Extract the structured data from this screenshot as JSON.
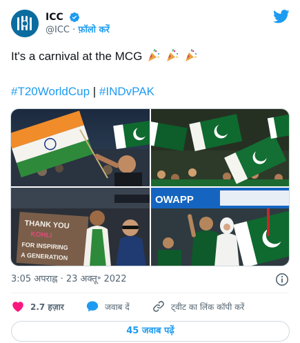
{
  "account": {
    "display_name": "ICC",
    "handle": "@ICC",
    "dot": "·",
    "follow_label": "फ़ॉलो करें",
    "avatar_icon": "icc-logo-icon",
    "verified_icon": "verified-badge-icon"
  },
  "brand": {
    "logo_icon": "twitter-bird-icon",
    "accent": "#1d9bf0"
  },
  "tweet": {
    "text": "It's a carnival at the MCG",
    "emoji_icon": "party-popper-icon",
    "hashtags": [
      "#T20WorldCup",
      "#INDvPAK"
    ],
    "separator": "|"
  },
  "media": {
    "photo_1": {
      "kind": "india-flag-fan-photo"
    },
    "photo_2": {
      "kind": "pakistan-flags-crowd-photo"
    },
    "photo_3": {
      "kind": "fans-with-banner-photo",
      "sign_lines": [
        "THANK YOU",
        "KOHLI",
        "FOR INSPIRING",
        "A GENERATION"
      ]
    },
    "photo_4": {
      "kind": "pakistan-fans-stands-photo",
      "banner_text": "OWAPP"
    }
  },
  "meta": {
    "time": "3:05 अपराह्न",
    "dot": "·",
    "date": "23 अक्तू॰ 2022",
    "info_icon": "info-circle-icon"
  },
  "actions": {
    "like_count": "2.7 हज़ार",
    "reply_label": "जवाब दें",
    "copy_link_label": "ट्वीट का लिंक कॉपी करें"
  },
  "read_replies_label": "45 जवाब पढ़ें",
  "colors": {
    "like": "#f91880",
    "reply": "#1d9bf0",
    "text_secondary": "#536471"
  }
}
